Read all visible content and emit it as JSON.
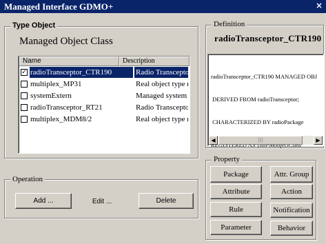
{
  "window": {
    "title": "Managed Interface GDMO+",
    "close_glyph": "×"
  },
  "type_object": {
    "group_label": "Type Object",
    "heading": "Managed Object Class",
    "columns": {
      "name": "Name",
      "description": "Description"
    },
    "rows": [
      {
        "name": "radioTransceptor_CTR190",
        "description": "Radio Transceptor",
        "checked": true,
        "selected": true
      },
      {
        "name": "multiplex_MP31",
        "description": "Real object type multiplex",
        "checked": false,
        "selected": false
      },
      {
        "name": "systemExtern",
        "description": "Managed system or sub",
        "checked": false,
        "selected": false
      },
      {
        "name": "radioTransceptor_RT21",
        "description": "Radio Transceptor",
        "checked": false,
        "selected": false
      },
      {
        "name": "multiplex_MDM8/2",
        "description": "Real object type multiplex",
        "checked": false,
        "selected": false
      }
    ]
  },
  "operation": {
    "group_label": "Operation",
    "add_label": "Add ...",
    "edit_label": "Edit ...",
    "delete_label": "Delete"
  },
  "definition": {
    "group_label": "Definition",
    "title": "radioTransceptor_CTR190",
    "lines": [
      "radioTransceptor_CTR190 MANAGED OBJ",
      " DERIVED FROM radioTransceptor;",
      " CHARACTERIZED BY radioPackage",
      "REGISTERED AS {nm-MobjectClass"
    ],
    "scroll_left": "◀",
    "scroll_right": "▶",
    "scroll_thumb": "|||"
  },
  "property": {
    "group_label": "Property",
    "package_label": "Package",
    "attr_group_label": "Attr. Group",
    "attribute_label": "Attribute",
    "action_label": "Action",
    "rule_label": "Rule",
    "notification_label": "Notification",
    "parameter_label": "Parameter",
    "behavior_label": "Behavior"
  },
  "colors": {
    "selection": "#0a246a",
    "face": "#d4d0c8",
    "title_bar": "#0a246a"
  }
}
